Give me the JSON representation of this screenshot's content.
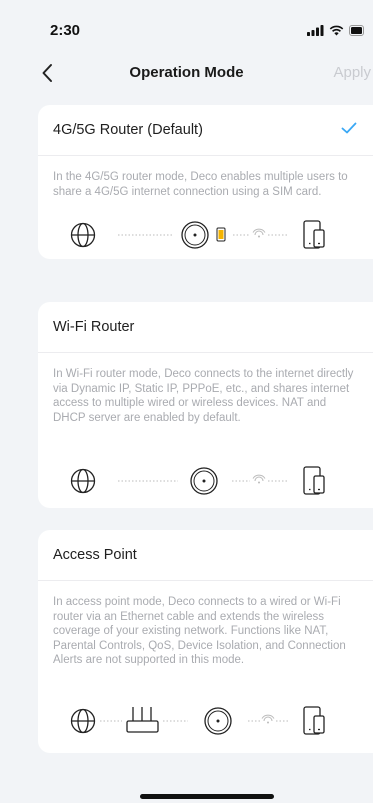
{
  "status_bar": {
    "time": "2:30",
    "icons": [
      "cellular-signal-icon",
      "wifi-icon",
      "battery-icon"
    ]
  },
  "nav": {
    "back_icon": "chevron-left-icon",
    "title": "Operation Mode",
    "apply_label": "Apply"
  },
  "modes": [
    {
      "title": "4G/5G Router (Default)",
      "selected": true,
      "description": "In the 4G/5G router mode, Deco enables multiple users to share a 4G/5G internet connection using a SIM card.",
      "diagram": [
        "globe-icon",
        "deco-unit-icon",
        "sim-card-icon",
        "wifi-signal-icon",
        "devices-icon"
      ]
    },
    {
      "title": "Wi-Fi Router",
      "selected": false,
      "description": "In Wi-Fi router mode, Deco connects to the internet directly via Dynamic IP, Static IP, PPPoE, etc., and shares internet access to multiple wired or wireless devices. NAT and DHCP server are enabled by default.",
      "diagram": [
        "globe-icon",
        "deco-unit-icon",
        "wifi-signal-icon",
        "devices-icon"
      ]
    },
    {
      "title": "Access Point",
      "selected": false,
      "description": "In access point mode, Deco connects to a wired or Wi-Fi router via an Ethernet cable and extends the wireless coverage of your existing network. Functions like NAT, Parental Controls, QoS, Device Isolation, and Connection Alerts are not supported in this mode.",
      "diagram": [
        "globe-icon",
        "router-icon",
        "deco-unit-icon",
        "wifi-signal-icon",
        "devices-icon"
      ]
    }
  ],
  "colors": {
    "accent": "#3aa8f5",
    "background": "#f2f4f7",
    "card": "#ffffff",
    "secondary_text": "#a9abb0",
    "disabled_text": "#c9cbd0",
    "sim_yellow": "#f5b400"
  }
}
